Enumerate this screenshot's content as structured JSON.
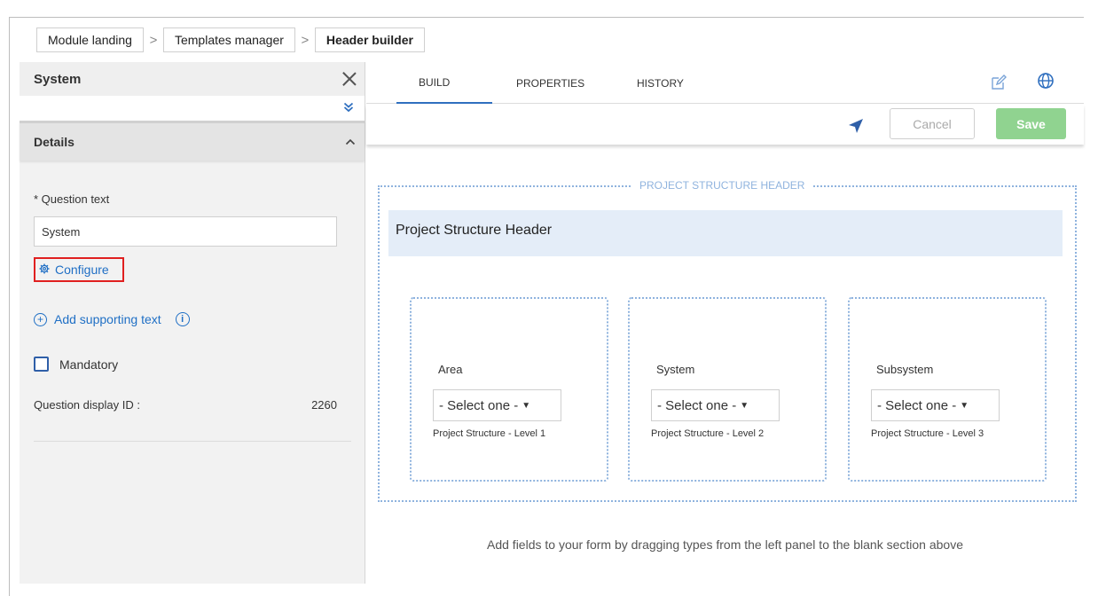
{
  "breadcrumb": {
    "items": [
      "Module landing",
      "Templates manager",
      "Header builder"
    ],
    "separator": ">"
  },
  "left_panel": {
    "title": "System",
    "collapse_glyph": "≫",
    "details_label": "Details",
    "details_chevron": "^",
    "question_label": "* Question text",
    "question_value": "System",
    "configure_label": "Configure",
    "add_supporting_label": "Add supporting text",
    "mandatory_label": "Mandatory",
    "display_id_label": "Question display ID :",
    "display_id_value": "2260"
  },
  "tabs": [
    {
      "label": "BUILD",
      "active": true
    },
    {
      "label": "PROPERTIES",
      "active": false
    },
    {
      "label": "HISTORY",
      "active": false
    }
  ],
  "actions": {
    "cancel_label": "Cancel",
    "save_label": "Save",
    "save_color": "#90d390"
  },
  "canvas": {
    "section_caption": "PROJECT STRUCTURE HEADER",
    "section_title": "Project Structure Header",
    "cards": [
      {
        "label": "Area",
        "select_text": "- Select one -",
        "sub": "Project Structure - Level 1"
      },
      {
        "label": "System",
        "select_text": "- Select one -",
        "sub": "Project Structure - Level 2"
      },
      {
        "label": "Subsystem",
        "select_text": "- Select one -",
        "sub": "Project Structure - Level 3"
      }
    ],
    "hint": "Add fields to your form by dragging types from the left panel to the blank section above"
  },
  "colors": {
    "accent": "#2f6fbf",
    "link": "#1f6fc5",
    "highlight_box": "#e02020",
    "section_border": "#8fb3de",
    "section_band": "#e4edf8"
  }
}
